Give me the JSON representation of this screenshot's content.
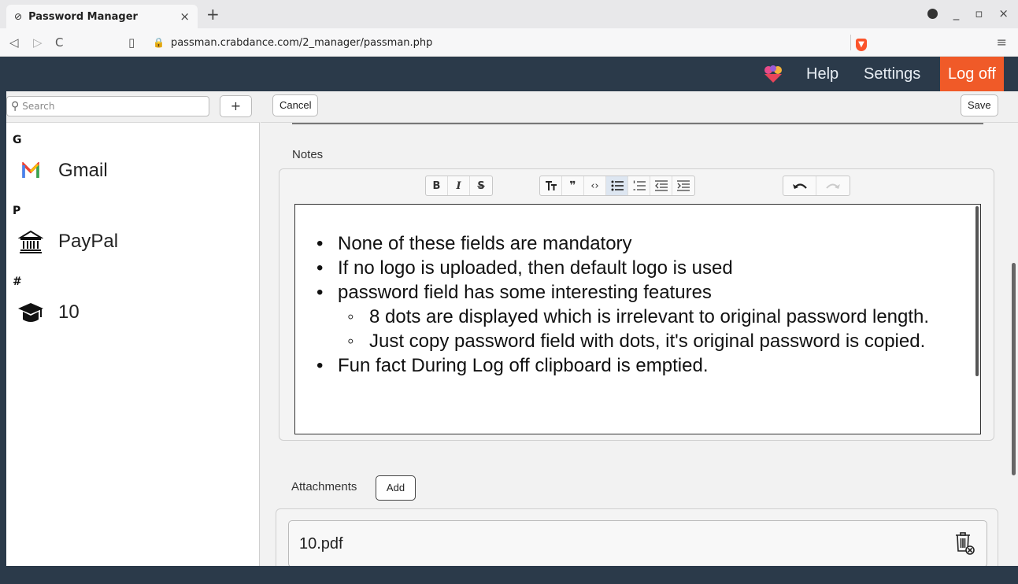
{
  "browser": {
    "tab_title": "Password Manager",
    "tab_close": "×",
    "new_tab": "+",
    "url": "passman.crabdance.com/2_manager/passman.php",
    "window_controls": [
      "_",
      "▫",
      "×"
    ]
  },
  "appbar": {
    "help": "Help",
    "settings": "Settings",
    "logoff": "Log off"
  },
  "sidebar": {
    "search_placeholder": "Search",
    "add_label": "+",
    "groups": [
      {
        "letter": "G",
        "entries": [
          {
            "name": "Gmail",
            "icon": "gmail-icon"
          }
        ]
      },
      {
        "letter": "P",
        "entries": [
          {
            "name": "PayPal",
            "icon": "bank-icon"
          }
        ]
      },
      {
        "letter": "#",
        "entries": [
          {
            "name": "10",
            "icon": "graduation-cap-icon"
          }
        ]
      }
    ]
  },
  "main": {
    "cancel_label": "Cancel",
    "save_label": "Save",
    "notes_label": "Notes",
    "toolbar": {
      "bold": "B",
      "italic": "I",
      "strike": "S"
    },
    "notes": {
      "b1": "None of these fields are mandatory",
      "b2": "If no logo is uploaded, then default logo is used",
      "b3": "password field has some interesting features",
      "b3a": "8 dots are displayed which is irrelevant to original password length.",
      "b3b": "Just copy password field with dots, it's original password is copied.",
      "b4": "Fun fact During Log off clipboard is emptied."
    },
    "attachments_label": "Attachments",
    "attachments_add": "Add",
    "attachments": [
      {
        "name": "10.pdf"
      }
    ]
  },
  "colors": {
    "appbar": "#2b3a4a",
    "logoff": "#f05a28",
    "active_tool": "#dde6f1"
  }
}
